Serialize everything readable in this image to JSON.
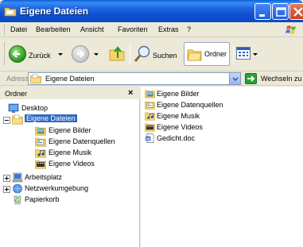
{
  "window": {
    "title": "Eigene Dateien"
  },
  "menubar": {
    "items": [
      "Datei",
      "Bearbeiten",
      "Ansicht",
      "Favoriten",
      "Extras",
      "?"
    ]
  },
  "toolbar": {
    "back_label": "Zurück",
    "search_label": "Suchen",
    "folders_label": "Ordner"
  },
  "addressbar": {
    "label": "Adresse",
    "value": "Eigene Dateien",
    "go_label": "Wechseln zu"
  },
  "folder_pane": {
    "title": "Ordner",
    "close_glyph": "×",
    "tree": [
      {
        "label": "Desktop",
        "icon": "desktop-icon"
      },
      {
        "label": "Eigene Dateien",
        "icon": "my-documents-icon",
        "selected": true
      },
      {
        "label": "Eigene Bilder",
        "icon": "my-pictures-folder-icon"
      },
      {
        "label": "Eigene Datenquellen",
        "icon": "data-sources-folder-icon"
      },
      {
        "label": "Eigene Musik",
        "icon": "my-music-folder-icon"
      },
      {
        "label": "Eigene Videos",
        "icon": "my-videos-folder-icon"
      },
      {
        "label": "Arbeitsplatz",
        "icon": "my-computer-icon"
      },
      {
        "label": "Netzwerkumgebung",
        "icon": "network-places-icon"
      },
      {
        "label": "Papierkorb",
        "icon": "recycle-bin-icon"
      }
    ]
  },
  "file_pane": {
    "items": [
      {
        "label": "Eigene Bilder",
        "icon": "my-pictures-folder-icon"
      },
      {
        "label": "Eigene Datenquellen",
        "icon": "data-sources-folder-icon"
      },
      {
        "label": "Eigene Musik",
        "icon": "my-music-folder-icon"
      },
      {
        "label": "Eigene Videos",
        "icon": "my-videos-folder-icon"
      },
      {
        "label": "Gedicht.doc",
        "icon": "word-document-icon"
      }
    ]
  },
  "colors": {
    "title_bar": "#0A4AC4",
    "selection": "#316AC5",
    "chrome": "#ECE9D8"
  }
}
